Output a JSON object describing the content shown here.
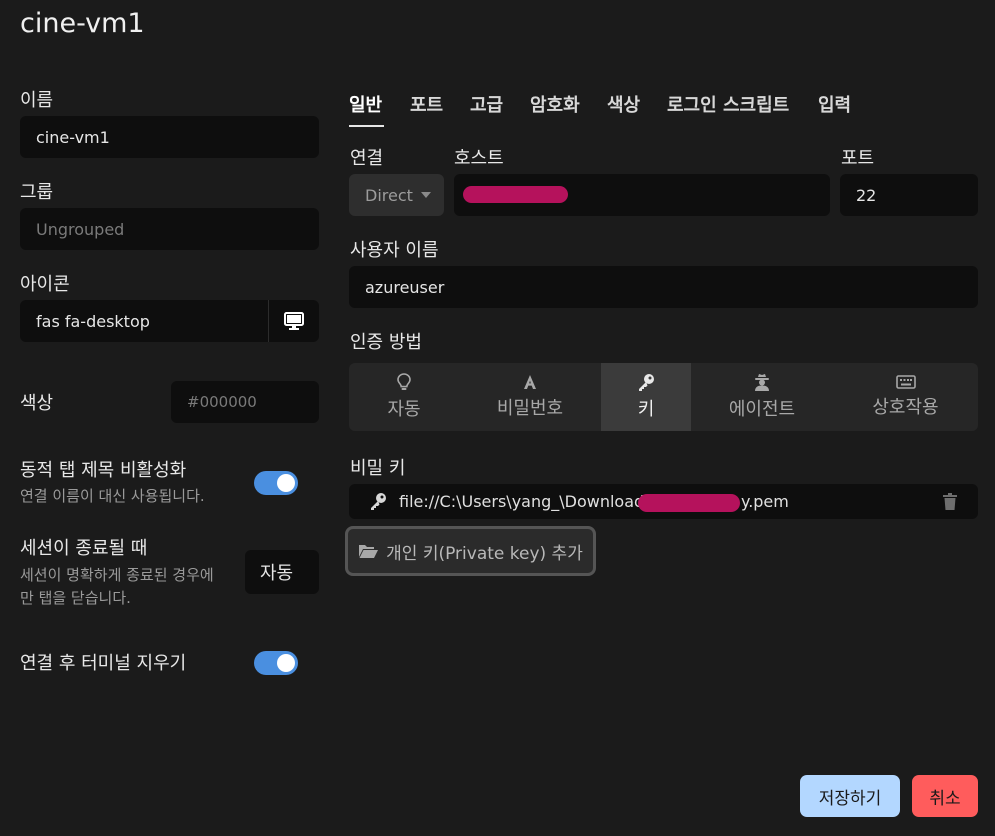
{
  "title": "cine-vm1",
  "left": {
    "name_label": "이름",
    "name_value": "cine-vm1",
    "group_label": "그룹",
    "group_placeholder": "Ungrouped",
    "icon_label": "아이콘",
    "icon_value": "fas fa-desktop",
    "color_label": "색상",
    "color_placeholder": "#000000",
    "dynamic_tab_label": "동적 탭 제목 비활성화",
    "dynamic_tab_sub": "연결 이름이 대신 사용됩니다.",
    "session_end_label": "세션이 종료될 때",
    "session_end_sub_line1": "세션이 명확하게 종료된 경우에",
    "session_end_sub_line2": "만 탭을 닫습니다.",
    "session_end_value": "자동",
    "clear_terminal_label": "연결 후 터미널 지우기"
  },
  "tabs": [
    "일반",
    "포트",
    "고급",
    "암호화",
    "색상",
    "로그인 스크립트",
    "입력"
  ],
  "general": {
    "connection_label": "연결",
    "connection_value": "Direct",
    "host_label": "호스트",
    "port_label": "포트",
    "port_value": "22",
    "username_label": "사용자 이름",
    "username_value": "azureuser",
    "auth_label": "인증 방법",
    "auth_methods": [
      {
        "icon": "lightbulb-icon",
        "label": "자동"
      },
      {
        "icon": "font-icon",
        "label": "비밀번호"
      },
      {
        "icon": "key-icon",
        "label": "키"
      },
      {
        "icon": "user-secret-icon",
        "label": "에이전트"
      },
      {
        "icon": "keyboard-icon",
        "label": "상호작용"
      }
    ],
    "auth_selected": "키",
    "secret_key_label": "비밀 키",
    "key_path_start": "file://C:\\Users\\yang_\\Downloads\\",
    "key_path_end": "y.pem",
    "add_key_button": "개인 키(Private key) 추가"
  },
  "footer": {
    "save": "저장하기",
    "cancel": "취소"
  },
  "colors": {
    "toggle_on": "#4a8fe0",
    "save_bg": "#b3d7ff",
    "cancel_bg": "#ff5c5c",
    "redaction": "#b5125c"
  }
}
